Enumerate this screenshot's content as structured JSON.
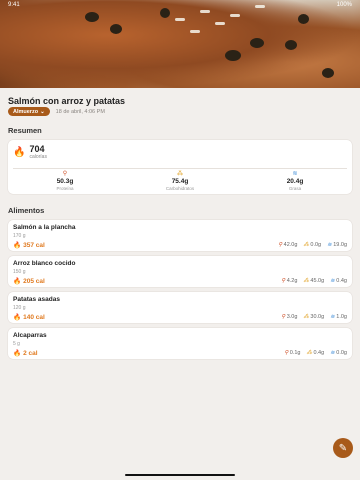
{
  "status": {
    "time": "9:41",
    "battery": "100%"
  },
  "dish": {
    "title": "Salmón con arroz y patatas",
    "meal": "Almuerzo",
    "date": "18 de abril, 4:06 PM"
  },
  "summary": {
    "heading": "Resumen",
    "calories": "704",
    "calories_label": "calorías",
    "protein": {
      "value": "50.3g",
      "label": "Proteína"
    },
    "carbs": {
      "value": "75.4g",
      "label": "Carbohidratos"
    },
    "fat": {
      "value": "20.4g",
      "label": "Grasa"
    }
  },
  "foods_heading": "Alimentos",
  "foods": [
    {
      "name": "Salmón a la plancha",
      "qty": "170 g",
      "cal": "357 cal",
      "p": "42.0g",
      "c": "0.0g",
      "f": "19.0g"
    },
    {
      "name": "Arroz blanco cocido",
      "qty": "150 g",
      "cal": "205 cal",
      "p": "4.2g",
      "c": "45.0g",
      "f": "0.4g"
    },
    {
      "name": "Patatas asadas",
      "qty": "120 g",
      "cal": "140 cal",
      "p": "3.0g",
      "c": "30.0g",
      "f": "1.0g"
    },
    {
      "name": "Alcaparras",
      "qty": "5 g",
      "cal": "2 cal",
      "p": "0.1g",
      "c": "0.4g",
      "f": "0.0g"
    }
  ],
  "icons": {
    "protein": "drumstick-icon",
    "carbs": "wheat-icon",
    "fat": "drop-icon",
    "calories": "flame-icon",
    "edit": "pencil-icon"
  },
  "colors": {
    "accent": "#a85a1a",
    "calories": "#e07a20",
    "protein": "#d0542c",
    "carbs": "#e0a020",
    "fat": "#3b8ad6"
  }
}
